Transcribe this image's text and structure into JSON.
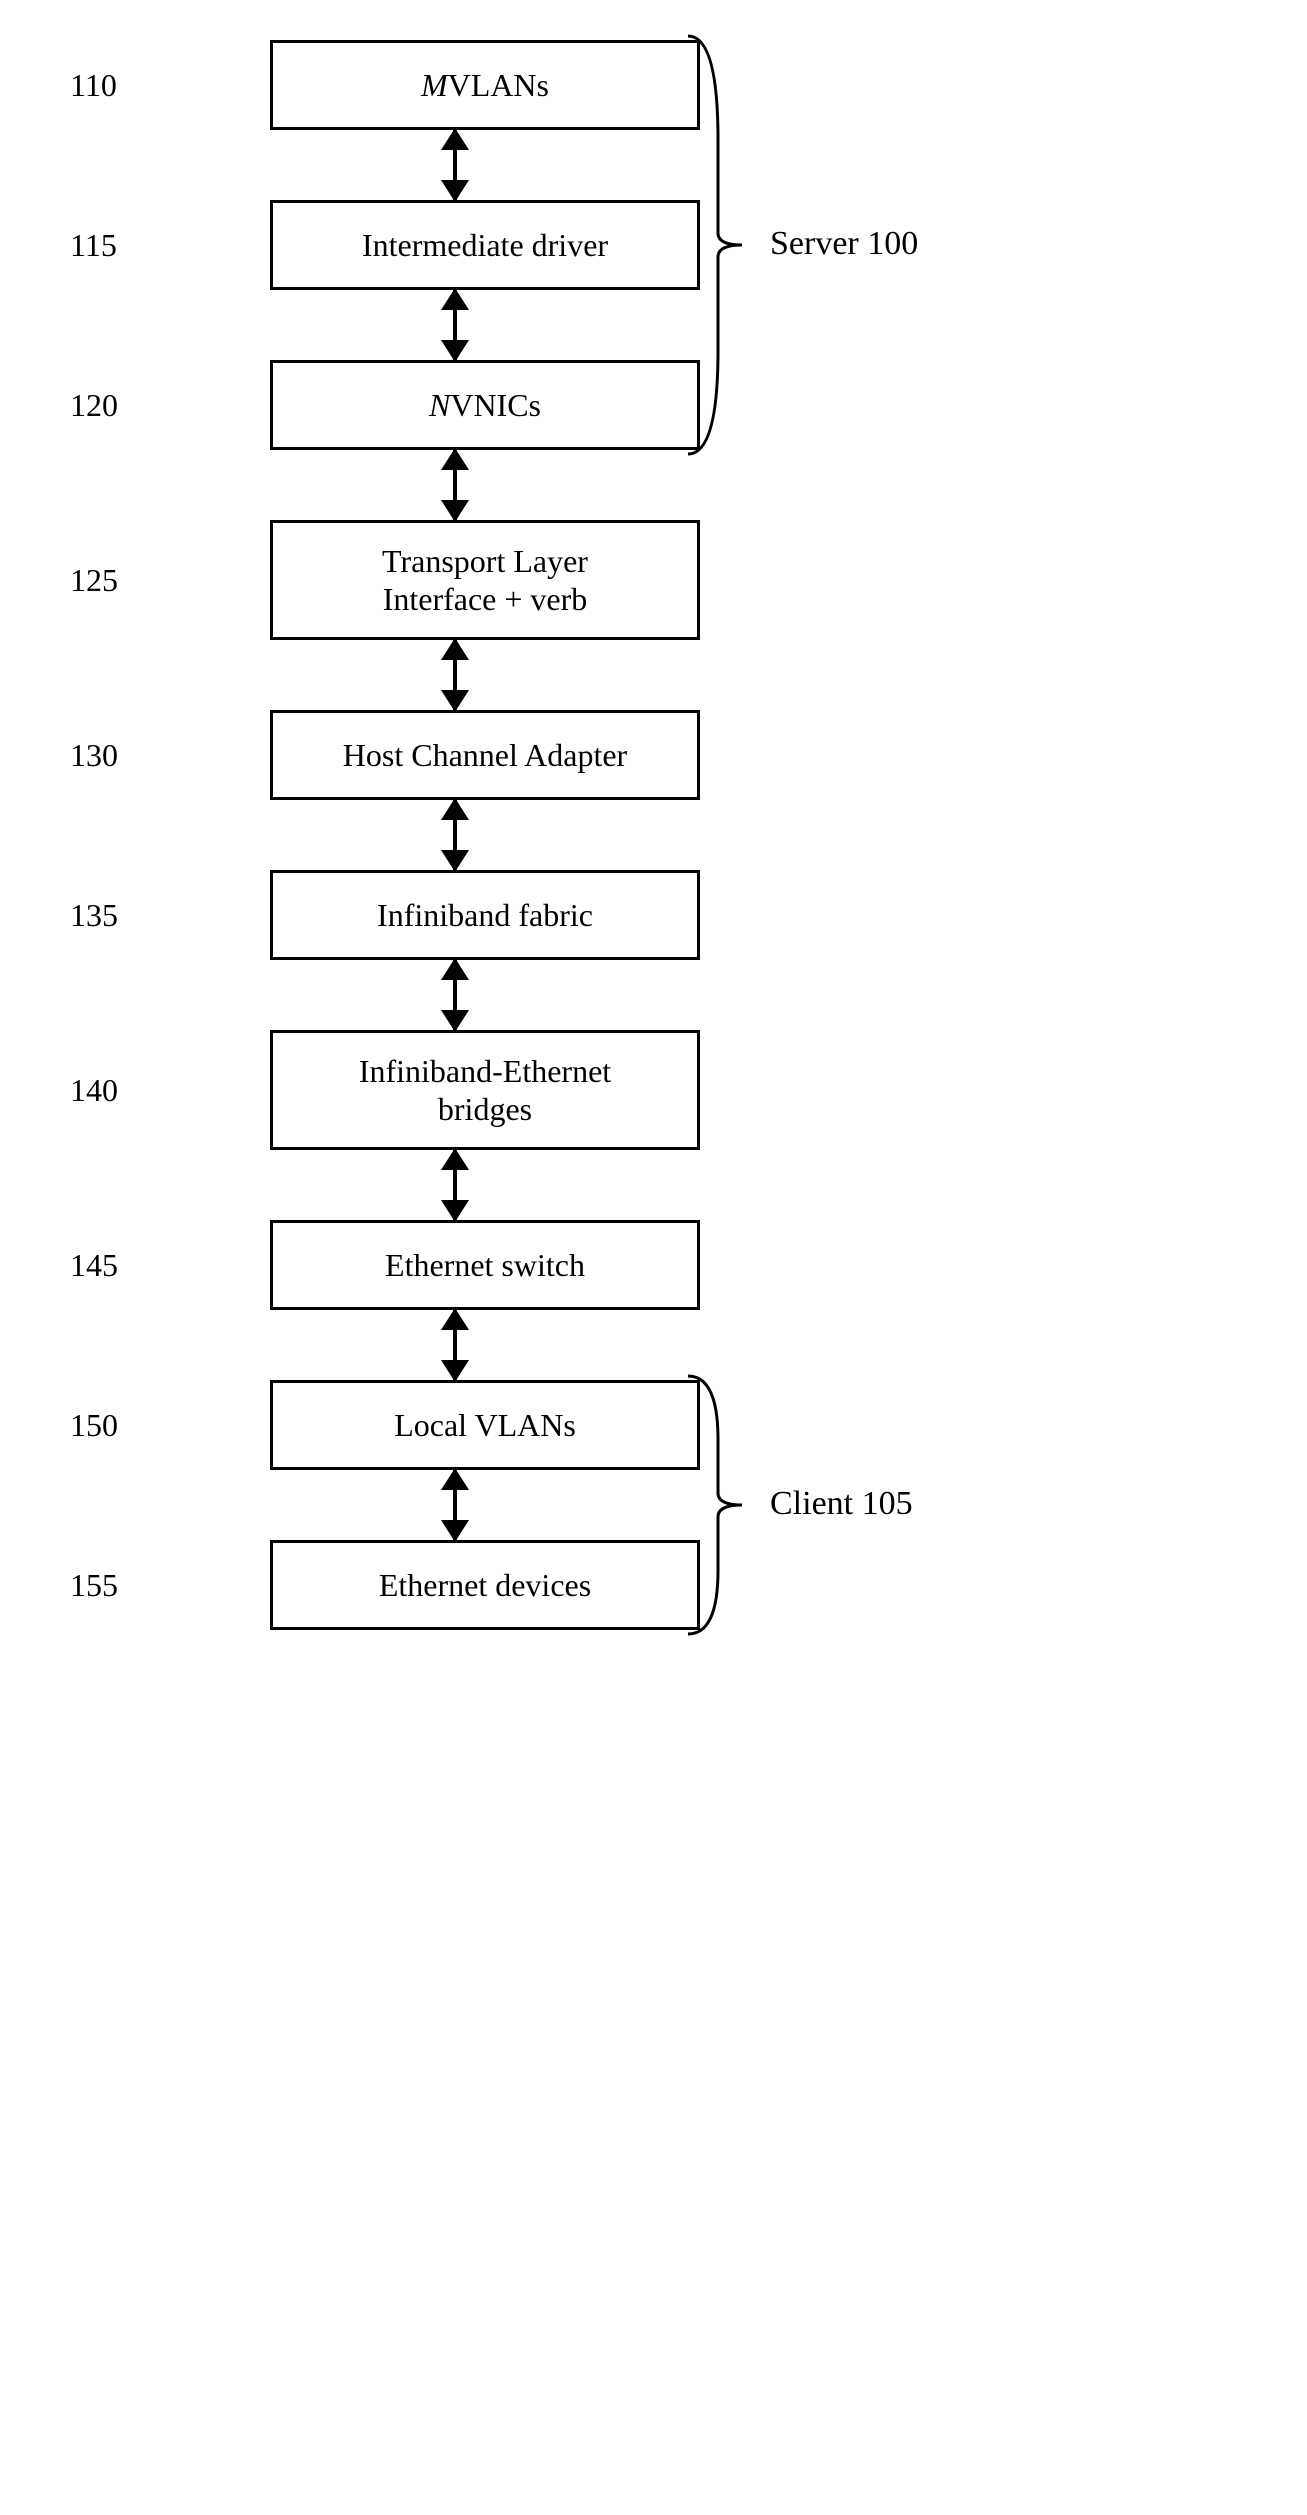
{
  "nodes": [
    {
      "ref": "110",
      "label_html": "<i>M</i> VLANs"
    },
    {
      "ref": "115",
      "label_html": "Intermediate driver"
    },
    {
      "ref": "120",
      "label_html": "<i>N</i> VNICs"
    },
    {
      "ref": "125",
      "label_html": "Transport Layer<br>Interface + verb",
      "tall": true
    },
    {
      "ref": "130",
      "label_html": "Host Channel Adapter"
    },
    {
      "ref": "135",
      "label_html": "Infiniband fabric"
    },
    {
      "ref": "140",
      "label_html": "Infiniband-Ethernet<br>bridges",
      "tall": true
    },
    {
      "ref": "145",
      "label_html": "Ethernet switch"
    },
    {
      "ref": "150",
      "label_html": "Local VLANs"
    },
    {
      "ref": "155",
      "label_html": "Ethernet devices"
    }
  ],
  "groups": [
    {
      "label": "Server 100",
      "from_ref": "110",
      "to_ref": "120"
    },
    {
      "label": "Client 105",
      "from_ref": "150",
      "to_ref": "155"
    }
  ]
}
